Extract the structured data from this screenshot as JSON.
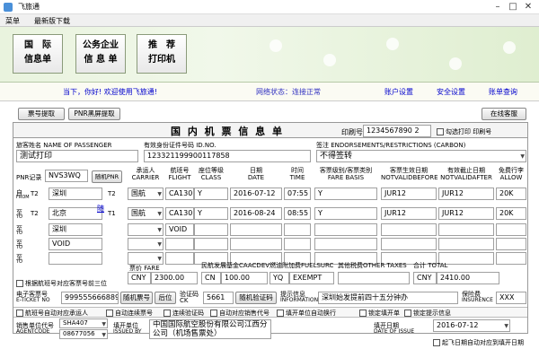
{
  "window": {
    "title": "飞旅通"
  },
  "menu": [
    "菜单",
    "最新版下载"
  ],
  "banner_buttons": [
    {
      "line1": "国　际",
      "line2": "信息单"
    },
    {
      "line1": "公务企业",
      "line2": "信 息 单"
    },
    {
      "line1": "推　荐",
      "line2": "打印机"
    }
  ],
  "status": {
    "welcome": "当下，你好! 欢迎使用飞旅通!",
    "network": "网络状态：连接正常",
    "links": [
      "账户设置",
      "安全设置",
      "账单查询"
    ]
  },
  "toolbar": {
    "fetch": "票号提取",
    "pnr_fetch": "PNR黑屏提取",
    "online_service": "在线客服"
  },
  "form": {
    "title": "国 内 机 票 信 息 单",
    "print_no_label": "印刷号",
    "print_no": "1234567890 2",
    "check_print_label": "勾选打印 印刷号",
    "passenger_label": "旅客姓名 NAME OF PASSENGER",
    "passenger": "测试打印",
    "id_label": "有效身份证件号码 ID.NO.",
    "id_no": "123321199900117858",
    "endorse_label": "签注 ENDORSEMENTS/RESTRICTIONS (CARBON)",
    "endorse": "不得签转",
    "pnr_label": "PNR记录",
    "pnr": "NVS3WQ",
    "random_pnr": "随机PNR",
    "col_headers": [
      {
        "cn": "承运人",
        "en": "CARRIER"
      },
      {
        "cn": "航班号",
        "en": "FLIGHT"
      },
      {
        "cn": "座位等级",
        "en": "CLASS"
      },
      {
        "cn": "日期",
        "en": "DATE"
      },
      {
        "cn": "时间",
        "en": "TIME"
      },
      {
        "cn": "客票级别/客票类别",
        "en": "FARE BASIS"
      },
      {
        "cn": "客票生效日期",
        "en": "NOTVALIDBEFORE"
      },
      {
        "cn": "有效截止日期",
        "en": "NOTVALIDAFTER"
      },
      {
        "cn": "免费行李",
        "en": "ALLOW"
      }
    ],
    "segments": [
      {
        "dir": "自",
        "dir2": "FROM",
        "code": "T2",
        "city": "深圳",
        "term": "T2",
        "carrier": "国航",
        "flight": "CA1306",
        "class": "Y",
        "date": "2016-07-12",
        "time": "07:55",
        "fare": "Y",
        "nvb": "JUR12",
        "nva": "JUR12",
        "allow": "20K"
      },
      {
        "dir": "至",
        "dir2": "TO",
        "code": "T2",
        "city": "北京",
        "term": "T1",
        "carrier": "国航",
        "flight": "CA1305",
        "class": "Y",
        "date": "2016-08-24",
        "time": "08:55",
        "fare": "Y",
        "nvb": "JUR12",
        "nva": "JUR12",
        "allow": "20K"
      },
      {
        "dir": "至",
        "dir2": "TO",
        "code": "",
        "city": "深圳",
        "term": "",
        "carrier": "",
        "flight": "VOID",
        "class": "",
        "date": "",
        "time": "",
        "fare": "",
        "nvb": "",
        "nva": "",
        "allow": ""
      },
      {
        "dir": "至",
        "dir2": "TO",
        "code": "",
        "city": "VOID",
        "term": "",
        "carrier": "",
        "flight": "",
        "class": "",
        "date": "",
        "time": "",
        "fare": "",
        "nvb": "",
        "nva": "",
        "allow": ""
      },
      {
        "dir": "至",
        "dir2": "TO",
        "code": "",
        "city": "",
        "term": "",
        "carrier": "",
        "flight": "",
        "class": "",
        "date": "",
        "time": "",
        "fare": "",
        "nvb": "",
        "nva": "",
        "allow": ""
      }
    ],
    "link_mark": "随",
    "fare_label": "票价 FARE",
    "fare_cur": "CNY",
    "fare": "2300.00",
    "caac_label": "民航发展基金CAACDEV",
    "caac_cur": "CN",
    "caac": "100.00",
    "fuel_label": "燃油附加费FUELSURC",
    "fuel_cur": "YQ",
    "fuel": "EXEMPT",
    "other_label": "其他税费OTHER TAXES",
    "total_label": "合计 TOTAL",
    "total_cur": "CNY",
    "total": "2410.00",
    "fare_calc_check": "根据航班号对应客票号前三位",
    "eticket_label": "电子客票号",
    "eticket_label2": "E-TICKET NO",
    "eticket": "9995556668894",
    "random_ticket": "随机票号",
    "backspace": "后位",
    "verify_label": "验证码",
    "verify_label2": "CK",
    "verify": "5661",
    "random_verify": "随机验证码",
    "info_label": "提示信息",
    "info_label2": "INFORMATION",
    "info": "深圳始发提前四十五分钟办",
    "insure_label": "保险费",
    "insure_label2": "INSURENCE",
    "insure": "XXX",
    "options": [
      "航班号自动对应承运人",
      "自动连续票号",
      "连续验证码",
      "自动对应销售代号",
      "填开单位自动换行",
      "锁定填开单",
      "锁定提示信息"
    ],
    "agent_label": "销售单位代号",
    "agent_label2": "AGENTCODE",
    "agent1": "SHA407",
    "agent2": "08677056",
    "issuer_label": "填开单位",
    "issuer_label2": "ISSUED BY",
    "issuer": "中国国际航空股份有限公司江西分公司（机场售票处）",
    "issue_date_label": "填开日期",
    "issue_date_label2": "DATE OF ISSUE",
    "issue_date": "2016-07-12",
    "auto_date_label": "起飞日期自动对应到填开日期"
  },
  "colors": {
    "banner": "#e9f3de",
    "link": "#0000cc",
    "title_bg": "#f4f4f4"
  }
}
